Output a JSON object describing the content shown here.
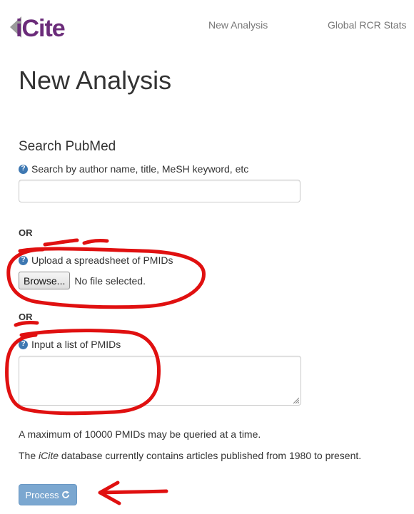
{
  "navbar": {
    "logo_text": "iCite",
    "links": [
      "New Analysis",
      "Global RCR Stats"
    ]
  },
  "page_title": "New Analysis",
  "search": {
    "section_title": "Search PubMed",
    "help_label": "Search by author name, title, MeSH keyword, etc",
    "value": "",
    "placeholder": ""
  },
  "or_label": "OR",
  "upload": {
    "help_label": "Upload a spreadsheet of PMIDs",
    "browse_label": "Browse...",
    "file_status": "No file selected."
  },
  "pmid_list": {
    "help_label": "Input a list of PMIDs",
    "value": ""
  },
  "info": {
    "max_notice": "A maximum of 10000 PMIDs may be queried at a time.",
    "db_prefix": "The ",
    "db_name": "iCite",
    "db_suffix": " database currently contains articles published from 1980 to present."
  },
  "process_button": {
    "label": "Process",
    "icon": "refresh-icon"
  },
  "colors": {
    "brand_purple": "#6b2c7a",
    "link_gray": "#777777",
    "help_blue": "#3e78b2",
    "process_blue": "#7ba7d0",
    "annotation_red": "#e01010"
  },
  "icons": [
    "help-icon",
    "refresh-icon",
    "resize-grip-icon"
  ]
}
